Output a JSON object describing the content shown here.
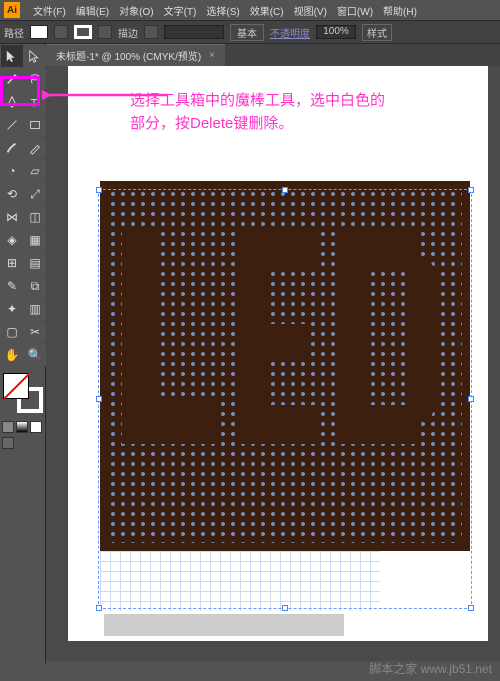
{
  "menubar": {
    "items": [
      "文件(F)",
      "编辑(E)",
      "对象(O)",
      "文字(T)",
      "选择(S)",
      "效果(C)",
      "视图(V)",
      "窗口(W)",
      "帮助(H)"
    ]
  },
  "optionsbar": {
    "path_label": "路径",
    "stroke_label": "描边",
    "basic_label": "基本",
    "opacity_label": "不透明度",
    "opacity_value": "100%",
    "style_label": "样式"
  },
  "document": {
    "tab_title": "未标题-1* @ 100% (CMYK/预览)",
    "close": "×"
  },
  "annotation": {
    "line1": "选择工具箱中的魔棒工具，选中白色的",
    "line2": "部分，按Delete键删除。"
  },
  "tools": {
    "names": [
      "selection",
      "direct-select",
      "magic-wand",
      "lasso",
      "pen",
      "type",
      "line",
      "rectangle",
      "brush",
      "pencil",
      "blob",
      "eraser",
      "rotate",
      "scale",
      "width",
      "free-transform",
      "shape-builder",
      "perspective",
      "mesh",
      "gradient",
      "eyedropper",
      "blend",
      "symbol-spray",
      "graph",
      "artboard",
      "slice",
      "hand",
      "zoom"
    ]
  },
  "artwork": {
    "text": "LED"
  },
  "watermark": "脚本之家 www.jb51.net"
}
